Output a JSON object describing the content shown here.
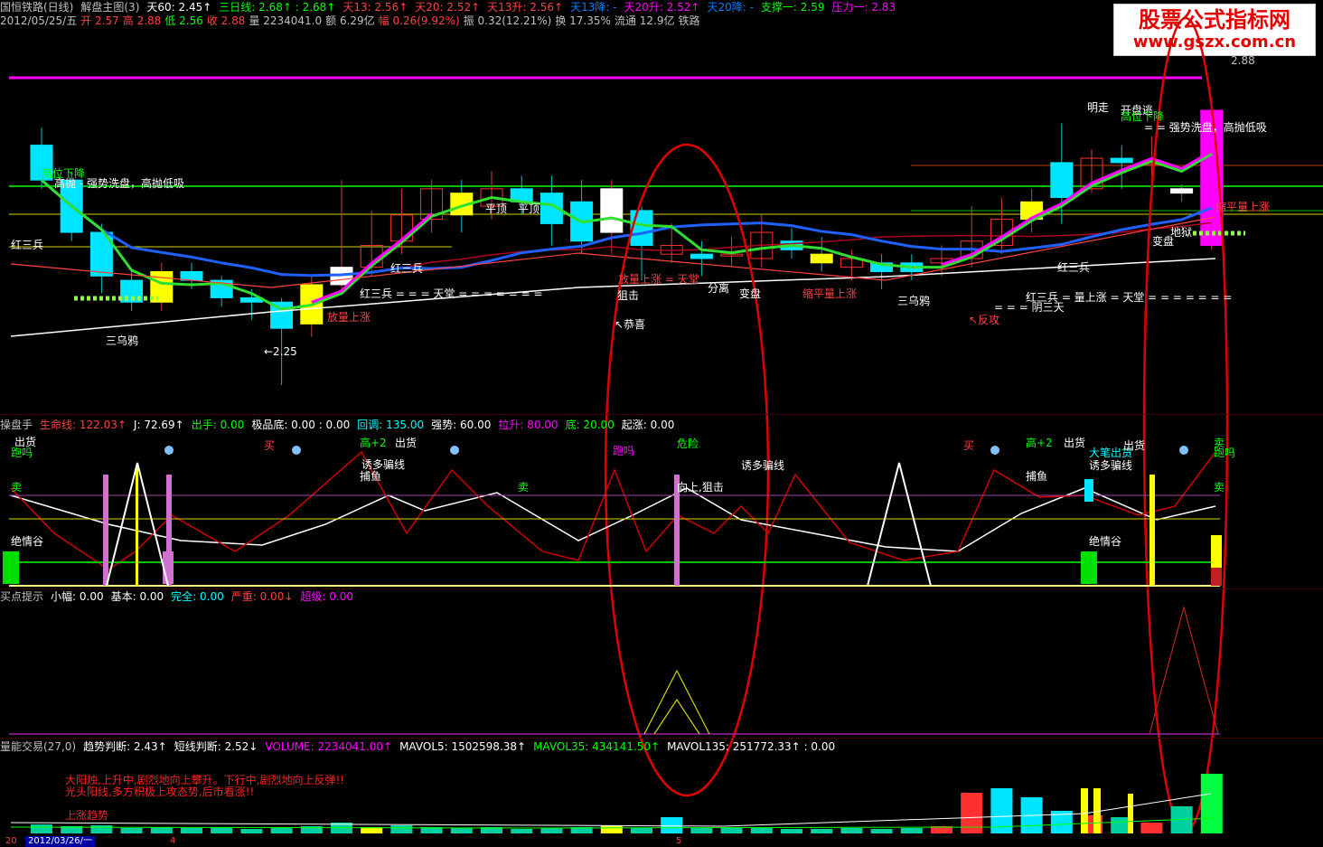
{
  "header": {
    "line1": [
      {
        "text": "国恒铁路(日线)",
        "color": "#c0c0c0"
      },
      {
        "text": "解盘主图(3)",
        "color": "#c0c0c0"
      },
      {
        "text": "天60: 2.45↑",
        "color": "#ffffff"
      },
      {
        "text": "三日线: 2.68↑ : 2.68↑",
        "color": "#00ff00"
      },
      {
        "text": "天13: 2.56↑",
        "color": "#ff4040"
      },
      {
        "text": "天20: 2.52↑",
        "color": "#ff4040"
      },
      {
        "text": "天13升: 2.56↑",
        "color": "#ff4040"
      },
      {
        "text": "天13降: -",
        "color": "#0080ff"
      },
      {
        "text": "天20升: 2.52↑",
        "color": "#ff00ff"
      },
      {
        "text": "天20降: -",
        "color": "#0080ff"
      },
      {
        "text": "支撑一: 2.59",
        "color": "#00ff00"
      },
      {
        "text": "压力一: 2.83",
        "color": "#ff00ff"
      }
    ],
    "line2": [
      {
        "text": "2012/05/25/五",
        "color": "#c0c0c0"
      },
      {
        "text": "开 2.57",
        "color": "#ff4040"
      },
      {
        "text": "高 2.88",
        "color": "#ff4040"
      },
      {
        "text": "低 2.56",
        "color": "#00ff00"
      },
      {
        "text": "收 2.88",
        "color": "#ff4040"
      },
      {
        "text": "量 2234041.0",
        "color": "#c0c0c0"
      },
      {
        "text": "额 6.29亿",
        "color": "#c0c0c0"
      },
      {
        "text": "幅 0.26(9.92%)",
        "color": "#ff4040"
      },
      {
        "text": "振 0.32(12.21%)",
        "color": "#c0c0c0"
      },
      {
        "text": "换 17.35%",
        "color": "#c0c0c0"
      },
      {
        "text": "流通 12.9亿",
        "color": "#c0c0c0"
      },
      {
        "text": "铁路",
        "color": "#c0c0c0"
      }
    ]
  },
  "watermark": {
    "line1": "股票公式指标网",
    "line2": "www.gszx.com.cn"
  },
  "main_labels": [
    {
      "t": "高位下降",
      "c": "#00ff00"
    },
    {
      "t": "高抛 - 强势洗盘，高抛低吸",
      "c": "#ffffff"
    },
    {
      "t": "红三兵",
      "c": "#ffffff"
    },
    {
      "t": "三乌鸦",
      "c": "#ffffff"
    },
    {
      "t": "←2.25",
      "c": "#ffffff"
    },
    {
      "t": "红三兵",
      "c": "#ffffff"
    },
    {
      "t": "红三兵 = = = 天堂 = = = = = = =",
      "c": "#ffffff"
    },
    {
      "t": "放量上涨",
      "c": "#ff4040"
    },
    {
      "t": "平顶",
      "c": "#ffffff"
    },
    {
      "t": "平顶",
      "c": "#ffffff"
    },
    {
      "t": "狙击",
      "c": "#ffffff"
    },
    {
      "t": "↖恭喜",
      "c": "#ffffff"
    },
    {
      "t": "放量上涨 = 天堂",
      "c": "#ff4040"
    },
    {
      "t": "分离",
      "c": "#ffffff"
    },
    {
      "t": "变盘",
      "c": "#ffffff"
    },
    {
      "t": "缩平量上涨",
      "c": "#ff4040"
    },
    {
      "t": "三乌鸦",
      "c": "#ffffff"
    },
    {
      "t": "↖反攻",
      "c": "#ff4040"
    },
    {
      "t": "= = = 阴三天",
      "c": "#ffffff"
    },
    {
      "t": "红三兵 = 量上涨 = 天堂 = = = = = = =",
      "c": "#ffffff"
    },
    {
      "t": "红三兵",
      "c": "#ffffff"
    },
    {
      "t": "明走",
      "c": "#ffffff"
    },
    {
      "t": "开盘逃",
      "c": "#ffffff"
    },
    {
      "t": "高位下降",
      "c": "#00ff00"
    },
    {
      "t": "= = 强势洗盘，高抛低吸",
      "c": "#ffffff"
    },
    {
      "t": "缩平量上涨",
      "c": "#ff4040"
    },
    {
      "t": "变盘",
      "c": "#ffffff"
    },
    {
      "t": "地狱",
      "c": "#ffffff"
    },
    {
      "t": "2.88",
      "c": "#c0c0c0"
    }
  ],
  "ind1": {
    "header": [
      {
        "text": "操盘手",
        "color": "#c0c0c0"
      },
      {
        "text": "生命线: 122.03↑",
        "color": "#ff4040"
      },
      {
        "text": "J: 72.69↑",
        "color": "#ffffff"
      },
      {
        "text": "出手: 0.00",
        "color": "#00ff00"
      },
      {
        "text": "极品底: 0.00 : 0.00",
        "color": "#ffffff"
      },
      {
        "text": "回调: 135.00",
        "color": "#00ffff"
      },
      {
        "text": "强势: 60.00",
        "color": "#ffffff"
      },
      {
        "text": "拉升: 80.00",
        "color": "#ff00ff"
      },
      {
        "text": "底: 20.00",
        "color": "#00ff00"
      },
      {
        "text": "起涨: 0.00",
        "color": "#ffffff"
      }
    ],
    "labels": [
      {
        "t": "出货",
        "c": "#ffffff"
      },
      {
        "t": "跑吗",
        "c": "#00ff00"
      },
      {
        "t": "卖",
        "c": "#00ff00"
      },
      {
        "t": "绝情谷",
        "c": "#ffffff"
      },
      {
        "t": "买",
        "c": "#ff4040"
      },
      {
        "t": "高+2",
        "c": "#00ff00"
      },
      {
        "t": "出货",
        "c": "#ffffff"
      },
      {
        "t": "诱多骗线",
        "c": "#ffffff"
      },
      {
        "t": "捕鱼",
        "c": "#ffffff"
      },
      {
        "t": "卖",
        "c": "#00ff00"
      },
      {
        "t": "跑吗",
        "c": "#ff00ff"
      },
      {
        "t": "危险",
        "c": "#00ff00"
      },
      {
        "t": "向上,狙击",
        "c": "#ffffff"
      },
      {
        "t": "诱多骗线",
        "c": "#ffffff"
      },
      {
        "t": "买",
        "c": "#ff4040"
      },
      {
        "t": "高+2",
        "c": "#00ff00"
      },
      {
        "t": "出货",
        "c": "#ffffff"
      },
      {
        "t": "捕鱼",
        "c": "#ffffff"
      },
      {
        "t": "大笔出货",
        "c": "#00ffff"
      },
      {
        "t": "出货",
        "c": "#ffffff"
      },
      {
        "t": "诱多骗线",
        "c": "#ffffff"
      },
      {
        "t": "绝情谷",
        "c": "#ffffff"
      },
      {
        "t": "卖",
        "c": "#00ff00"
      },
      {
        "t": "卖",
        "c": "#00ff00"
      },
      {
        "t": "跑吗",
        "c": "#00ff00"
      }
    ]
  },
  "ind2": {
    "header": [
      {
        "text": "买点提示",
        "color": "#c0c0c0"
      },
      {
        "text": "小幅: 0.00",
        "color": "#ffffff"
      },
      {
        "text": "基本: 0.00",
        "color": "#ffffff"
      },
      {
        "text": "完全: 0.00",
        "color": "#00ffff"
      },
      {
        "text": "严重: 0.00↓",
        "color": "#ff4040"
      },
      {
        "text": "超级: 0.00",
        "color": "#ff00ff"
      }
    ]
  },
  "ind3": {
    "header": [
      {
        "text": "量能交易(27,0)",
        "color": "#c0c0c0"
      },
      {
        "text": "趋势判断: 2.43↑",
        "color": "#ffffff"
      },
      {
        "text": "短线判断: 2.52↓",
        "color": "#ffffff"
      },
      {
        "text": "VOLUME: 2234041.00↑",
        "color": "#ff00ff"
      },
      {
        "text": "MAVOL5: 1502598.38↑",
        "color": "#ffffff"
      },
      {
        "text": "MAVOL35: 434141.50↑",
        "color": "#00ff00"
      },
      {
        "text": "MAVOL135: 251772.33↑ : 0.00",
        "color": "#ffffff"
      }
    ],
    "notes": [
      {
        "t": "大阳烛,上升中,剧烈地向上攀升。下行中,剧烈地向上反弹!!",
        "c": "#ff2020"
      },
      {
        "t": "光头阳线,多方积极上攻态势,后市看涨!!",
        "c": "#ff2020"
      },
      {
        "t": "上涨趋势",
        "c": "#ff2020"
      }
    ]
  },
  "statusbar": {
    "date": "2012/03/26/一",
    "left": "20",
    "mark1": "4",
    "mark2": "5"
  },
  "chart_data": {
    "type": "candlestick",
    "candles": [
      [
        2.8,
        2.72,
        2.84,
        2.7
      ],
      [
        2.72,
        2.6,
        2.74,
        2.58
      ],
      [
        2.6,
        2.5,
        2.62,
        2.46
      ],
      [
        2.49,
        2.44,
        2.51,
        2.42
      ],
      [
        2.44,
        2.51,
        2.53,
        2.42
      ],
      [
        2.51,
        2.49,
        2.53,
        2.47
      ],
      [
        2.49,
        2.45,
        2.5,
        2.43
      ],
      [
        2.45,
        2.44,
        2.47,
        2.4
      ],
      [
        2.44,
        2.38,
        2.45,
        2.25
      ],
      [
        2.39,
        2.48,
        2.5,
        2.36
      ],
      [
        2.48,
        2.52,
        2.72,
        2.47
      ],
      [
        2.52,
        2.57,
        2.65,
        2.5
      ],
      [
        2.58,
        2.64,
        2.7,
        2.55
      ],
      [
        2.63,
        2.7,
        2.72,
        2.6
      ],
      [
        2.69,
        2.64,
        2.72,
        2.6
      ],
      [
        2.66,
        2.7,
        2.74,
        2.63
      ],
      [
        2.7,
        2.67,
        2.73,
        2.64
      ],
      [
        2.69,
        2.62,
        2.73,
        2.57
      ],
      [
        2.67,
        2.58,
        2.72,
        2.55
      ],
      [
        2.6,
        2.7,
        2.72,
        2.55
      ],
      [
        2.65,
        2.57,
        2.66,
        2.49
      ],
      [
        2.55,
        2.57,
        2.62,
        2.53
      ],
      [
        2.55,
        2.54,
        2.58,
        2.5
      ],
      [
        2.55,
        2.55,
        2.59,
        2.52
      ],
      [
        2.54,
        2.6,
        2.64,
        2.52
      ],
      [
        2.58,
        2.56,
        2.61,
        2.54
      ],
      [
        2.55,
        2.53,
        2.59,
        2.51
      ],
      [
        2.52,
        2.54,
        2.56,
        2.49
      ],
      [
        2.53,
        2.51,
        2.55,
        2.47
      ],
      [
        2.53,
        2.51,
        2.55,
        2.49
      ],
      [
        2.53,
        2.54,
        2.57,
        2.5
      ],
      [
        2.54,
        2.58,
        2.66,
        2.52
      ],
      [
        2.57,
        2.63,
        2.68,
        2.55
      ],
      [
        2.63,
        2.67,
        2.7,
        2.6
      ],
      [
        2.76,
        2.68,
        2.85,
        2.62
      ],
      [
        2.7,
        2.77,
        2.79,
        2.69
      ],
      [
        2.77,
        2.76,
        2.8,
        2.7
      ],
      [
        2.76,
        2.76,
        2.82,
        2.73
      ],
      [
        2.69,
        2.7,
        2.71,
        2.67
      ],
      [
        2.57,
        2.88,
        2.88,
        2.56
      ]
    ],
    "price_range": [
      2.2,
      3.05
    ]
  }
}
